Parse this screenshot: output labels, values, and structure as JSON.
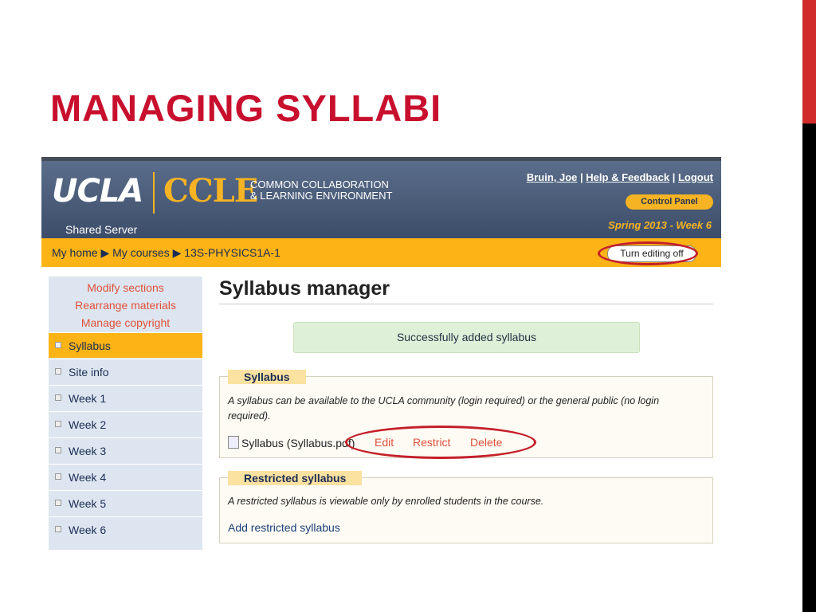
{
  "slide": {
    "title": "MANAGING SYLLABI"
  },
  "header": {
    "logo_ucla": "UCLA",
    "logo_ccle": "CCLE",
    "ccle_sub_line1": "COMMON COLLABORATION",
    "ccle_sub_line2": "& LEARNING ENVIRONMENT",
    "server": "Shared Server",
    "user_link": "Bruin, Joe",
    "help_link": "Help & Feedback",
    "logout_link": "Logout",
    "separator": "|",
    "control_panel": "Control Panel",
    "term": "Spring 2013 - Week 6"
  },
  "breadcrumb": {
    "home": "My home",
    "arrow": "▶",
    "courses": "My courses",
    "course": "13S-PHYSICS1A-1"
  },
  "toggle_edit": {
    "label": "Turn editing off"
  },
  "sidebar": {
    "links": [
      "Modify sections",
      "Rearrange materials",
      "Manage copyright"
    ],
    "items": [
      {
        "label": "Syllabus",
        "active": true
      },
      {
        "label": "Site info"
      },
      {
        "label": "Week 1"
      },
      {
        "label": "Week 2"
      },
      {
        "label": "Week 3"
      },
      {
        "label": "Week 4"
      },
      {
        "label": "Week 5"
      },
      {
        "label": "Week 6"
      }
    ]
  },
  "main": {
    "heading": "Syllabus manager",
    "success": "Successfully added syllabus",
    "syllabus": {
      "legend": "Syllabus",
      "desc_line1": "A syllabus can be available to the UCLA community (login required) or the general public (no login",
      "desc_line2": "required).",
      "file_label": "Syllabus (Syllabus.pdf)",
      "edit": "Edit",
      "restrict": "Restrict",
      "delete": "Delete"
    },
    "restricted": {
      "legend": "Restricted syllabus",
      "desc": "A restricted syllabus is viewable only by enrolled students in the course.",
      "add_link": "Add restricted syllabus"
    }
  },
  "colors": {
    "slide_title": "#c8102e",
    "brand_gold": "#fbb315",
    "header_blue": "#3c4d69",
    "link_red": "#e0503a",
    "annotation_ring": "#c41f2a"
  }
}
